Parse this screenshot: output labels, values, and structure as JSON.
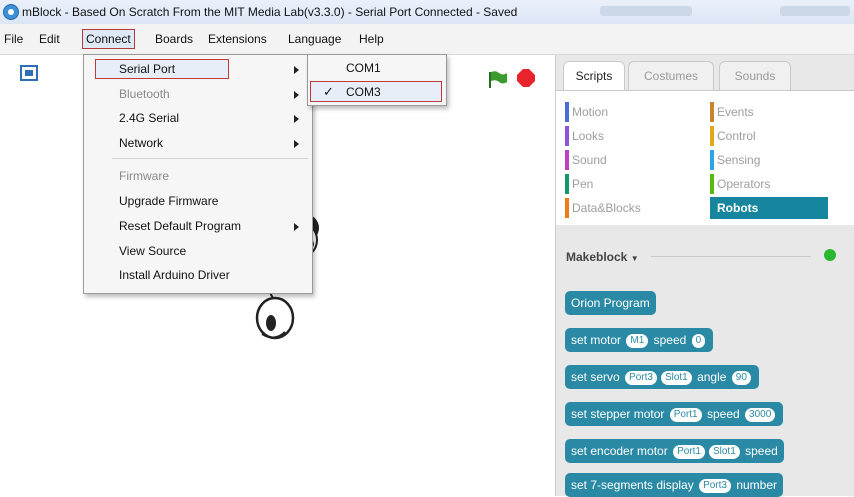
{
  "window": {
    "title": "mBlock - Based On Scratch From the MIT Media Lab(v3.3.0) - Serial Port Connected - Saved"
  },
  "menubar": {
    "file": "File",
    "edit": "Edit",
    "connect": "Connect",
    "boards": "Boards",
    "extensions": "Extensions",
    "language": "Language",
    "help": "Help"
  },
  "connect_menu": {
    "serial_port": "Serial Port",
    "bluetooth": "Bluetooth",
    "serial_24g": "2.4G Serial",
    "network": "Network",
    "firmware": "Firmware",
    "upgrade_firmware": "Upgrade Firmware",
    "reset_default_program": "Reset Default Program",
    "view_source": "View Source",
    "install_arduino_driver": "Install Arduino Driver"
  },
  "serial_submenu": {
    "com1": "COM1",
    "com3": "COM3",
    "check": "✓"
  },
  "tabs": {
    "scripts": "Scripts",
    "costumes": "Costumes",
    "sounds": "Sounds"
  },
  "categories": {
    "motion": "Motion",
    "looks": "Looks",
    "sound": "Sound",
    "pen": "Pen",
    "data_blocks": "Data&Blocks",
    "events": "Events",
    "control": "Control",
    "sensing": "Sensing",
    "operators": "Operators",
    "robots": "Robots"
  },
  "category_colors": {
    "motion": "#4a6cd4",
    "looks": "#8a55d7",
    "sound": "#bb42c3",
    "pen": "#0e9a6c",
    "data_blocks": "#ee7d16",
    "events": "#c88330",
    "control": "#e1a91a",
    "sensing": "#2ca5e2",
    "operators": "#5cb712",
    "robots": "#15869e"
  },
  "palette": {
    "extension_name": "Makeblock",
    "dropdown_arrow": "▼"
  },
  "blocks": {
    "orion_program": "Orion Program",
    "set_motor_prefix": "set motor",
    "set_motor_m": "M1",
    "set_motor_speed_label": "speed",
    "set_motor_speed": "0",
    "set_servo_prefix": "set servo",
    "set_servo_port": "Port3",
    "set_servo_slot": "Slot1",
    "set_servo_angle_label": "angle",
    "set_servo_angle": "90",
    "set_stepper_prefix": "set stepper motor",
    "set_stepper_port": "Port1",
    "set_stepper_speed_label": "speed",
    "set_stepper_speed": "3000",
    "set_encoder_prefix": "set encoder motor",
    "set_encoder_port": "Port1",
    "set_encoder_slot": "Slot1",
    "set_encoder_tail": "speed",
    "set_7seg_prefix": "set 7-segments display",
    "set_7seg_port": "Port3",
    "set_7seg_tail": "number"
  },
  "colors": {
    "block": "#2a8aa6",
    "highlight_border": "#c0393b",
    "led": "#29b82f",
    "stop": "#e8232b",
    "flag": "#3a9b2f"
  }
}
